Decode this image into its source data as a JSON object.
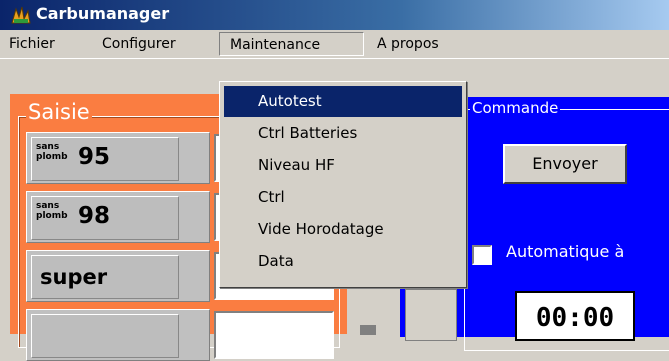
{
  "window": {
    "title": "Carbumanager",
    "icon": "fuel-pump-icon"
  },
  "menubar": {
    "items": [
      {
        "label": "Fichier"
      },
      {
        "label": "Configurer"
      },
      {
        "label": "Maintenance"
      },
      {
        "label": "A propos"
      }
    ]
  },
  "maintenance_menu": {
    "items": [
      {
        "label": "Autotest",
        "selected": true
      },
      {
        "label": "Ctrl Batteries"
      },
      {
        "label": "Niveau HF"
      },
      {
        "label": "Ctrl"
      },
      {
        "label": "Vide Horodatage"
      },
      {
        "label": "Data"
      }
    ]
  },
  "saisie": {
    "title": "Saisie",
    "fuels": [
      {
        "small": "sans plomb",
        "num": "95"
      },
      {
        "small": "sans plomb",
        "num": "98"
      },
      {
        "big": "super"
      }
    ]
  },
  "commande": {
    "title": "Commande",
    "send_label": "Envoyer",
    "auto_label": "Automatique à",
    "time": "00:00"
  },
  "colors": {
    "saisie_bg": "#fa7d41",
    "commande_bg": "#0000ff",
    "menu_highlight": "#0a246a"
  }
}
